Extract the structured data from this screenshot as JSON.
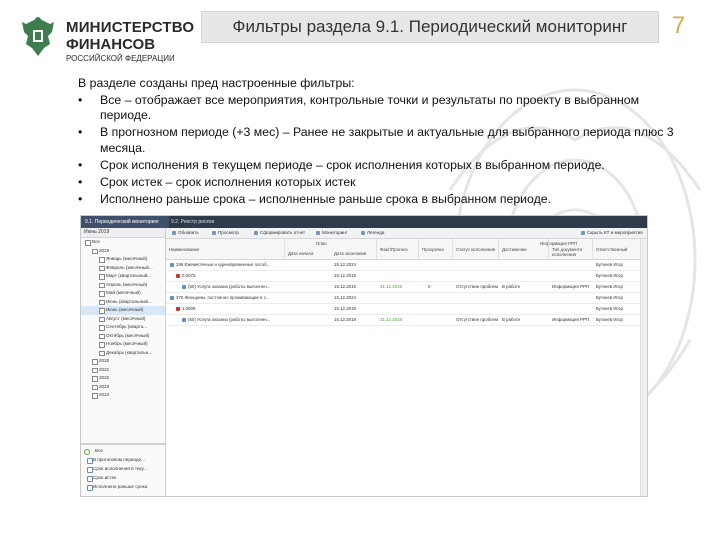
{
  "logo": {
    "line1": "МИНИСТЕРСТВО",
    "line2": "ФИНАНСОВ",
    "line3": "РОССИЙСКОЙ ФЕДЕРАЦИИ"
  },
  "slide": {
    "title": "Фильтры раздела 9.1. Периодический мониторинг",
    "page_number": "7"
  },
  "body": {
    "intro": "В разделе созданы пред настроенные фильтры:",
    "bullets": [
      "Все – отображает все мероприятия, контрольные точки и результаты по проекту в выбранном периоде.",
      "В прогнозном периоде (+3 мес) – Ранее не закрытые и актуальные для выбранного периода плюс 3 месяца.",
      "Срок исполнения в текущем периоде – срок исполнения которых в выбранном периоде.",
      "Срок истек – срок исполнения которых истек",
      "Исполнено раньше срока – исполненные раньше срока в выбранном периоде."
    ]
  },
  "screenshot": {
    "tabs": [
      "9.1. Периодический мониторинг",
      "9.2. Реестр рисков"
    ],
    "period_header": "Июнь 2019",
    "tree": [
      {
        "label": "Все",
        "indent": 0
      },
      {
        "label": "2019",
        "indent": 1
      },
      {
        "label": "Январь (месячный)",
        "indent": 2
      },
      {
        "label": "Февраль (месячный...",
        "indent": 2
      },
      {
        "label": "Март (квартальный...",
        "indent": 2
      },
      {
        "label": "Апрель (месячный)",
        "indent": 2
      },
      {
        "label": "Май (месячный)",
        "indent": 2
      },
      {
        "label": "Июнь (квартальный...",
        "indent": 2
      },
      {
        "label": "Июнь (месячный)",
        "indent": 2,
        "selected": true
      },
      {
        "label": "Август (месячный)",
        "indent": 2
      },
      {
        "label": "Сентябрь (кварта...",
        "indent": 2
      },
      {
        "label": "Октябрь (месячный)",
        "indent": 2
      },
      {
        "label": "Ноябрь (месячный)",
        "indent": 2
      },
      {
        "label": "Декабрь (квартальн...",
        "indent": 2
      },
      {
        "label": "2020",
        "indent": 1
      },
      {
        "label": "2021",
        "indent": 1
      },
      {
        "label": "2022",
        "indent": 1
      },
      {
        "label": "2023",
        "indent": 1
      },
      {
        "label": "2024",
        "indent": 1
      }
    ],
    "filters": [
      "Все",
      "В прогнозном периоде...",
      "Срок исполнения в теку...",
      "Срок истек",
      "Исполнено раньше срока"
    ],
    "toolbar": [
      "Обновить",
      "Просмотр",
      "Сформировать отчет",
      "Мониторинг",
      "Легенда",
      "Скрыть КТ и мероприятия"
    ],
    "columns": {
      "name": "Наименование",
      "plan": "План",
      "start": "Дата начала",
      "end": "Дата окончания",
      "fact": "Факт/Прогноз",
      "overdue": "Просрочка",
      "status": "Статус исполнения",
      "achievement": "Достижение",
      "info": "Информация РРП",
      "doc_type": "Тип документа исполнения",
      "responsible": "Ответственный"
    },
    "rows": [
      {
        "name": "286 Ежемесячные и единовременные пособ...",
        "start": "",
        "end": "15.12.2024",
        "fact": "",
        "overdue": "",
        "status": "",
        "achievement": "",
        "info": "",
        "resp": "Буткеев Игор",
        "level": 0,
        "mark": "#6a8bbf"
      },
      {
        "name": "0.0075",
        "start": "",
        "end": "15.12.2019",
        "fact": "",
        "overdue": "",
        "status": "",
        "achievement": "",
        "info": "",
        "resp": "Буткеев Игор",
        "level": 1,
        "mark": "#c0392b"
      },
      {
        "name": "(50) Услуга оказана (работы выполнен...",
        "start": "",
        "end": "15.12.2019",
        "fact": "31.12.2019",
        "overdue": "0",
        "status": "Отсутствие проблем",
        "achievement": "В работе",
        "info": "Информация РРП",
        "resp": "Буткеев Игор",
        "level": 2,
        "mark": "#6a8bbf"
      },
      {
        "name": "370 Женщины, постоянно проживающие в с...",
        "start": "",
        "end": "15.12.2024",
        "fact": "",
        "overdue": "",
        "status": "",
        "achievement": "",
        "info": "",
        "resp": "Буткеев Игор",
        "level": 0,
        "mark": "#6a8bbf"
      },
      {
        "name": "1.0009",
        "start": "",
        "end": "15.12.2019",
        "fact": "",
        "overdue": "",
        "status": "",
        "achievement": "",
        "info": "",
        "resp": "Буткеев Игор",
        "level": 1,
        "mark": "#c0392b"
      },
      {
        "name": "(50) Услуга оказана (работы выполнен...",
        "start": "",
        "end": "15.12.2019",
        "fact": "31.12.2019",
        "overdue": "",
        "status": "Отсутствие проблем",
        "achievement": "В работе",
        "info": "Информация РРП",
        "resp": "Буткеев Игор",
        "level": 2,
        "mark": "#6a8bbf"
      }
    ]
  }
}
